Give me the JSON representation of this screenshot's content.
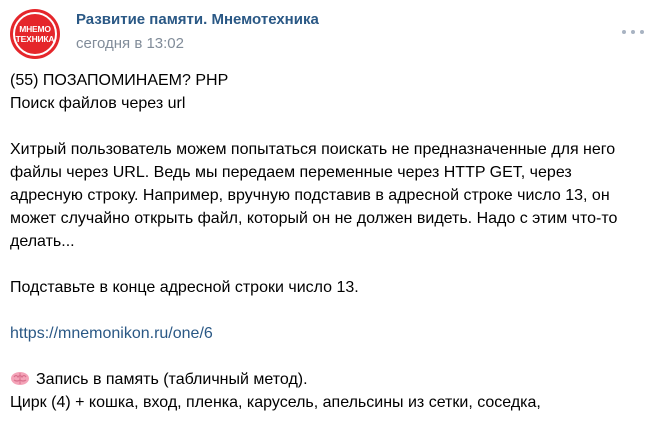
{
  "post": {
    "author": "Развитие памяти. Мнемотехника",
    "time": "сегодня в 13:02",
    "avatar": {
      "line1": "МНЕМО",
      "line2": "ТЕХНИКА",
      "color": "#e5262b"
    },
    "lines": {
      "l1": "(55) ПОЗАПОМИНАЕМ? PHP",
      "l2": "Поиск файлов через url",
      "p1": "Хитрый пользователь можем попытаться поискать не предназначенные для него",
      "p2": "файлы через URL. Ведь мы передаем переменные через HTTP GET, через",
      "p3": "адресную строку. Например, вручную подставив в адресной строке число 13, он",
      "p4": "может случайно открыть файл, который он не должен видеть. Надо с этим что-то",
      "p5": "делать...",
      "q1": "Подставьте в конце адресной строки число 13.",
      "link": "https://mnemonikon.ru/one/6",
      "m1": "Запись в память (табличный метод).",
      "m2": "Цирк (4) + кошка, вход, пленка, карусель, апельсины из сетки, соседка,"
    }
  },
  "icons": {
    "more": "more-horizontal-icon",
    "emoji": "brain-icon"
  },
  "colors": {
    "link": "#2a5885",
    "meta": "#818c99",
    "dots": "#a8b3c2"
  }
}
